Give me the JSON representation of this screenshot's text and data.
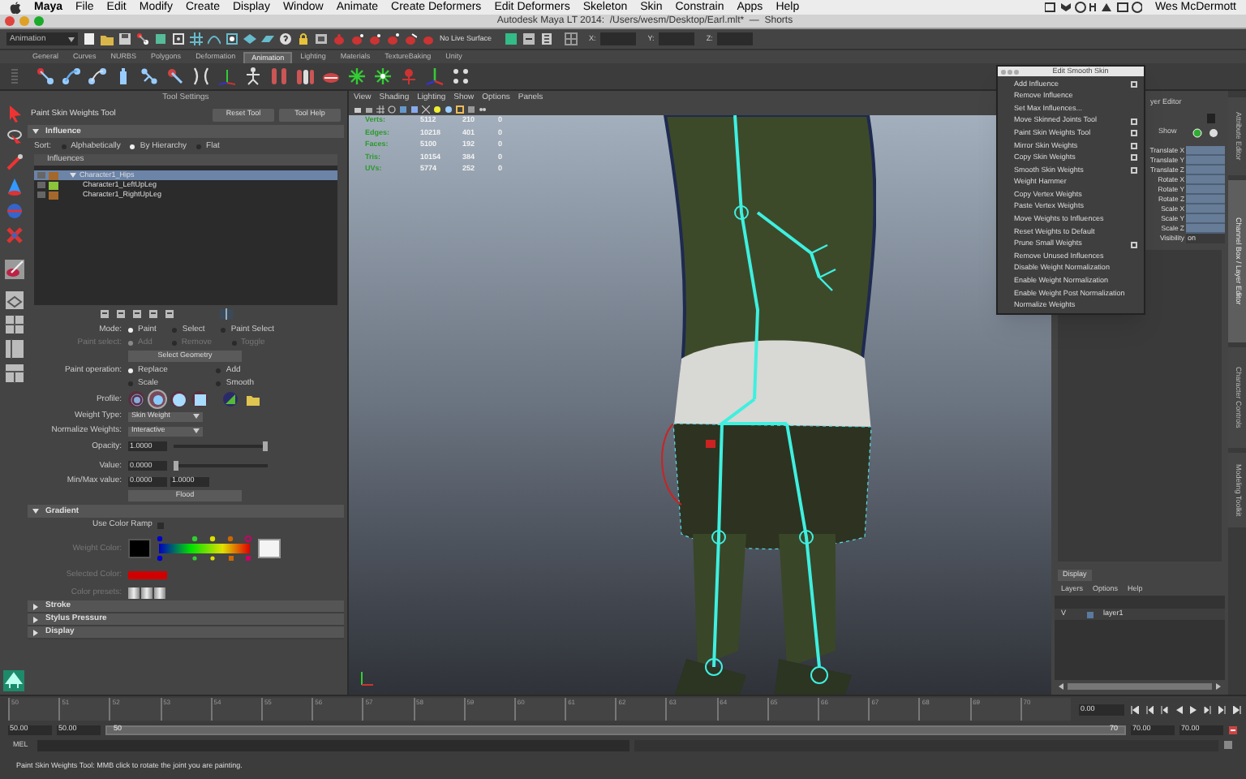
{
  "menu_bar": {
    "app": "Maya",
    "items": [
      "File",
      "Edit",
      "Modify",
      "Create",
      "Display",
      "Window",
      "Animate",
      "Create Deformers",
      "Edit Deformers",
      "Skeleton",
      "Skin",
      "Constrain",
      "Apps",
      "Help"
    ],
    "user": "Wes McDermott"
  },
  "window": {
    "title": "Autodesk Maya LT 2014:  /Users/wesm/Desktop/Earl.mlt*  —  Shorts"
  },
  "status_line": {
    "menu_set": "Animation",
    "live_surface": "No Live Surface",
    "fields": [
      "X:",
      "Y:",
      "Z:"
    ]
  },
  "shelf": {
    "tabs": [
      {
        "label": "General",
        "selected": false
      },
      {
        "label": "Curves",
        "selected": false
      },
      {
        "label": "NURBS",
        "selected": false
      },
      {
        "label": "Polygons",
        "selected": false
      },
      {
        "label": "Deformation",
        "selected": false
      },
      {
        "label": "Animation",
        "selected": true
      },
      {
        "label": "Lighting",
        "selected": false
      },
      {
        "label": "Materials",
        "selected": false
      },
      {
        "label": "TextureBaking",
        "selected": false
      },
      {
        "label": "Unity",
        "selected": false
      }
    ]
  },
  "tool_settings": {
    "title": "Tool Settings",
    "tool_name": "Paint Skin Weights Tool",
    "buttons": [
      "Reset Tool",
      "Tool Help"
    ]
  },
  "influence": {
    "title": "Influence",
    "expanded": true,
    "sort_label": "Sort:",
    "sort_options": [
      {
        "label": "Alphabetically",
        "selected": false
      },
      {
        "label": "By Hierarchy",
        "selected": true
      },
      {
        "label": "Flat",
        "selected": false
      }
    ],
    "list_label": "Influences",
    "items": [
      {
        "label": "Character1_Hips",
        "color": "#a4682c",
        "selected": true,
        "expanded": true,
        "children": [
          {
            "label": "Character1_LeftUpLeg",
            "color": "#8cc43c",
            "selected": false
          },
          {
            "label": "Character1_RightUpLeg",
            "color": "#a4682c",
            "selected": false
          }
        ]
      }
    ]
  },
  "mode": {
    "label": "Mode:",
    "options": [
      {
        "label": "Paint",
        "selected": true
      },
      {
        "label": "Select",
        "selected": false
      },
      {
        "label": "Paint Select",
        "selected": false
      }
    ]
  },
  "paint_select": {
    "label": "Paint select:",
    "disabled": true,
    "options": [
      {
        "label": "Add",
        "selected": true
      },
      {
        "label": "Remove",
        "selected": false
      },
      {
        "label": "Toggle",
        "selected": false
      }
    ]
  },
  "select_geometry": "Select Geometry",
  "paint_operation": {
    "label": "Paint operation:",
    "options": [
      {
        "label": "Replace",
        "selected": true
      },
      {
        "label": "Add",
        "selected": false
      },
      {
        "label": "Scale",
        "selected": false
      },
      {
        "label": "Smooth",
        "selected": false
      }
    ]
  },
  "profile": {
    "label": "Profile:",
    "brushes": [
      {
        "kind": "gaussian",
        "selected": false
      },
      {
        "kind": "soft",
        "selected": true
      },
      {
        "kind": "solid",
        "selected": false
      },
      {
        "kind": "square",
        "selected": false
      }
    ]
  },
  "weight_type": {
    "label": "Weight Type:",
    "value": "Skin Weight"
  },
  "normalize_weights": {
    "label": "Normalize Weights:",
    "value": "Interactive"
  },
  "opacity": {
    "label": "Opacity:",
    "value": "1.0000",
    "level": 1
  },
  "value": {
    "label": "Value:",
    "value": "0.0000",
    "level": 0
  },
  "min_max": {
    "label": "Min/Max value:",
    "min": "0.0000",
    "max": "1.0000"
  },
  "flood": "Flood",
  "gradient": {
    "title": "Gradient",
    "expanded": true,
    "use_color_ramp": {
      "label": "Use Color Ramp",
      "checked": false
    },
    "weight_color": {
      "label": "Weight Color:"
    },
    "selected_color": {
      "label": "Selected Color:",
      "color": "#d00000"
    },
    "color_presets": {
      "label": "Color presets:"
    }
  },
  "collapsed_sections": [
    {
      "title": "Stroke",
      "expanded": false
    },
    {
      "title": "Stylus Pressure",
      "expanded": false
    },
    {
      "title": "Display",
      "expanded": false
    }
  ],
  "viewport": {
    "menu": [
      "View",
      "Shading",
      "Lighting",
      "Show",
      "Options",
      "Panels"
    ],
    "hud": [
      {
        "label": "Verts:",
        "values": [
          "5112",
          "210",
          "0"
        ]
      },
      {
        "label": "Edges:",
        "values": [
          "10218",
          "401",
          "0"
        ]
      },
      {
        "label": "Faces:",
        "values": [
          "5100",
          "192",
          "0"
        ]
      },
      {
        "label": "Tris:",
        "values": [
          "10154",
          "384",
          "0"
        ]
      },
      {
        "label": "UVs:",
        "values": [
          "5774",
          "252",
          "0"
        ]
      }
    ]
  },
  "skin_menu": {
    "title": "Edit Smooth Skin",
    "items": [
      {
        "label": "Add Influence",
        "option_box": true
      },
      {
        "label": "Remove Influence",
        "option_box": false
      },
      {
        "label": "Set Max Influences...",
        "option_box": false
      },
      {
        "label": "Move Skinned Joints Tool",
        "option_box": true
      },
      {
        "label": "Paint Skin Weights Tool",
        "option_box": true
      },
      {
        "label": "Mirror Skin Weights",
        "option_box": true
      },
      {
        "label": "Copy Skin Weights",
        "option_box": true
      },
      {
        "label": "Smooth Skin Weights",
        "option_box": true
      },
      {
        "label": "Weight Hammer",
        "option_box": false
      },
      {
        "label": "Copy Vertex Weights",
        "option_box": false
      },
      {
        "label": "Paste Vertex Weights",
        "option_box": false
      },
      {
        "label": "Move Weights to Influences",
        "option_box": false
      },
      {
        "label": "Reset Weights to Default",
        "option_box": false
      },
      {
        "label": "Prune Small Weights",
        "option_box": true
      },
      {
        "label": "Remove Unused Influences",
        "option_box": false
      },
      {
        "label": "Disable Weight Normalization",
        "option_box": false
      },
      {
        "label": "Enable Weight Normalization",
        "option_box": false
      },
      {
        "label": "Enable Weight Post Normalization",
        "option_box": false
      },
      {
        "label": "Normalize Weights",
        "option_box": false
      }
    ]
  },
  "channel_box": {
    "header": "yer Editor",
    "show": "Show",
    "attributes": [
      {
        "name": "Translate X"
      },
      {
        "name": "Translate Y"
      },
      {
        "name": "Translate Z"
      },
      {
        "name": "Rotate X"
      },
      {
        "name": "Rotate Y"
      },
      {
        "name": "Rotate Z"
      },
      {
        "name": "Scale X"
      },
      {
        "name": "Scale Y"
      },
      {
        "name": "Scale Z"
      },
      {
        "name": "Visibility",
        "value": "on"
      }
    ]
  },
  "side_tabs": [
    {
      "label": "Attribute Editor",
      "selected": false
    },
    {
      "label": "Channel Box / Layer Editor",
      "selected": true
    },
    {
      "label": "Character Controls",
      "selected": false
    },
    {
      "label": "Modeling Toolkit",
      "selected": false
    }
  ],
  "layer_editor": {
    "tab": "Display",
    "menu": [
      "Layers",
      "Options",
      "Help"
    ],
    "layers": [
      {
        "visibility": "V",
        "name": "layer1"
      }
    ]
  },
  "timeline": {
    "ticks": [
      "50",
      "51",
      "52",
      "53",
      "54",
      "55",
      "56",
      "57",
      "58",
      "59",
      "60",
      "61",
      "62",
      "63",
      "64",
      "65",
      "66",
      "67",
      "68",
      "69",
      "70"
    ],
    "current_frame": "0.00"
  },
  "range": {
    "start": "50.00",
    "playback_start": "50.00",
    "slider_start": "50",
    "slider_end": "70",
    "playback_end": "70.00",
    "end": "70.00"
  },
  "command_line": {
    "label": "MEL"
  },
  "help_line": "Paint Skin Weights Tool: MMB click to rotate the joint you are painting."
}
